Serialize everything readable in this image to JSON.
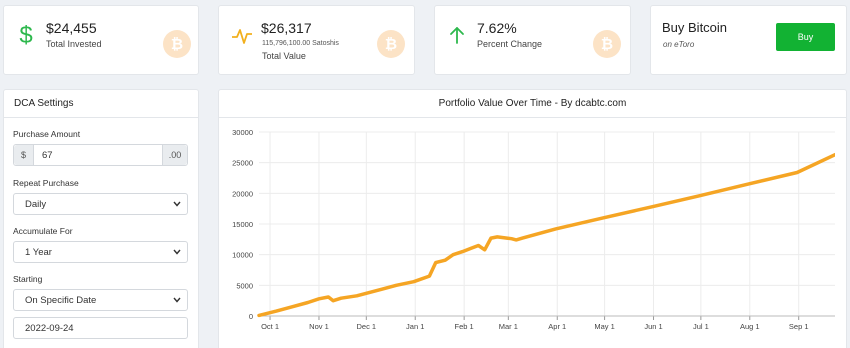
{
  "stats": {
    "invested": {
      "value": "$24,455",
      "label": "Total Invested",
      "icon": "dollar-icon",
      "color": "#2db84d"
    },
    "total_value": {
      "value": "$26,317",
      "sub": "115,796,100.00 Satoshis",
      "label": "Total Value",
      "icon": "pulse-icon",
      "color": "#f2b01e"
    },
    "percent": {
      "value": "7.62%",
      "label": "Percent Change",
      "icon": "arrow-up-icon",
      "color": "#2db84d"
    },
    "buy": {
      "title": "Buy Bitcoin",
      "subtitle": "on eToro",
      "button": "Buy",
      "color": "#12b233"
    },
    "badge_glyph": "₿",
    "badge_color": "#fce3c6"
  },
  "dca": {
    "title": "DCA Settings",
    "purchase_amount": {
      "label": "Purchase Amount",
      "prefix": "$",
      "value": "67",
      "suffix": ".00"
    },
    "repeat": {
      "label": "Repeat Purchase",
      "value": "Daily"
    },
    "accumulate": {
      "label": "Accumulate For",
      "value": "1 Year"
    },
    "starting": {
      "label": "Starting",
      "value": "On Specific Date"
    },
    "start_date": {
      "value": "2022-09-24"
    }
  },
  "chart_data": {
    "type": "line",
    "title": "Portfolio Value Over Time - By dcabtc.com",
    "xlabel": "",
    "ylabel": "",
    "ylim": [
      0,
      30000
    ],
    "yticks": [
      0,
      5000,
      10000,
      15000,
      20000,
      25000,
      30000
    ],
    "x_start": "2022-09-24",
    "x_end": "2023-09-24",
    "xticks": [
      "Oct 1",
      "Nov 1",
      "Dec 1",
      "Jan 1",
      "Feb 1",
      "Mar 1",
      "Apr 1",
      "May 1",
      "Jun 1",
      "Jul 1",
      "Aug 1",
      "Sep 1"
    ],
    "xtick_dates": [
      "2022-10-01",
      "2022-11-01",
      "2022-12-01",
      "2023-01-01",
      "2023-02-01",
      "2023-03-01",
      "2023-04-01",
      "2023-05-01",
      "2023-06-01",
      "2023-07-01",
      "2023-08-01",
      "2023-09-01"
    ],
    "line_color": "#f5a524",
    "grid": true,
    "series": [
      {
        "x": [
          "2022-09-24",
          "2022-10-05",
          "2022-10-15",
          "2022-10-25",
          "2022-11-01",
          "2022-11-07",
          "2022-11-10",
          "2022-11-15",
          "2022-11-25",
          "2022-12-01",
          "2022-12-10",
          "2022-12-20",
          "2022-12-31",
          "2023-01-10",
          "2023-01-14",
          "2023-01-20",
          "2023-01-25",
          "2023-01-31",
          "2023-02-05",
          "2023-02-10",
          "2023-02-14",
          "2023-02-18",
          "2023-02-22",
          "2023-02-28",
          "2023-03-03",
          "2023-03-06",
          "2023-03-10",
          "2023-03-31",
          "2023-04-30",
          "2023-05-31",
          "2023-06-30",
          "2023-07-31",
          "2023-08-31",
          "2023-09-24"
        ],
        "y": [
          100,
          800,
          1500,
          2200,
          2800,
          3100,
          2500,
          2900,
          3300,
          3700,
          4300,
          5000,
          5600,
          6500,
          8700,
          9100,
          10000,
          10500,
          11000,
          11500,
          10800,
          12700,
          12900,
          12700,
          12600,
          12400,
          12700,
          14200,
          16000,
          17800,
          19600,
          21500,
          23400,
          26300
        ]
      }
    ]
  }
}
